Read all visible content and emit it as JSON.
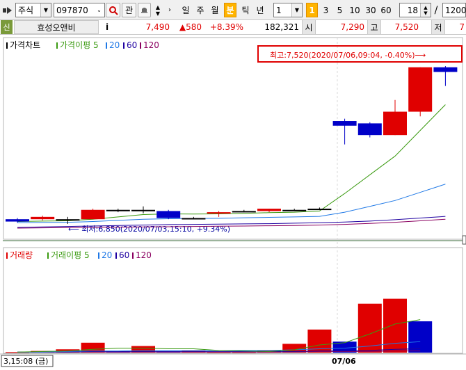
{
  "toolbar": {
    "market_label": "주식",
    "code_value": "097870",
    "watch_label": "관",
    "periods": [
      "일",
      "주",
      "월",
      "분",
      "틱",
      "년"
    ],
    "active_period": "분",
    "interval_value": "1",
    "minute_options": [
      "1",
      "3",
      "5",
      "10",
      "30",
      "60"
    ],
    "active_minute": "1",
    "view_count_value": "18",
    "slash": "/",
    "total_count_value": "1200"
  },
  "quote": {
    "badge": "신",
    "name": "효성오앤비",
    "info_label": "i",
    "price": "7,490",
    "change": "▲580",
    "change_rate": "+8.39%",
    "volume": "182,321",
    "open_label": "시",
    "open": "7,290",
    "high_label": "고",
    "high": "7,520",
    "low_label": "저",
    "low_partial": "7"
  },
  "colors": {
    "up": "#e00000",
    "down": "#0000c8",
    "ma5": "#3a9a10",
    "ma20": "#1e78e6",
    "ma60": "#1e00a0",
    "ma120": "#8a0060",
    "highlight": "#e00000"
  },
  "chart_data": [
    {
      "type": "candlestick",
      "title": "가격차트",
      "legend": [
        {
          "label": "가격이평 5",
          "color": "#3a9a10"
        },
        {
          "label": "20",
          "color": "#1e78e6"
        },
        {
          "label": "60",
          "color": "#1e00a0"
        },
        {
          "label": "120",
          "color": "#8a0060"
        }
      ],
      "annotations": {
        "high": "최고:7,520(2020/07/06,09:04, -0.40%)⟶",
        "low": "⟵ 최저:6,850(2020/07/03,15:10, +9.34%)"
      },
      "ylim": [
        6820,
        7540
      ],
      "candles": [
        {
          "open": 6870,
          "high": 6875,
          "low": 6855,
          "close": 6860,
          "color": "down"
        },
        {
          "open": 6870,
          "high": 6885,
          "low": 6865,
          "close": 6880,
          "color": "up"
        },
        {
          "open": 6870,
          "high": 6880,
          "low": 6850,
          "close": 6870,
          "color": "flat"
        },
        {
          "open": 6870,
          "high": 6915,
          "low": 6870,
          "close": 6910,
          "color": "up"
        },
        {
          "open": 6910,
          "high": 6915,
          "low": 6900,
          "close": 6910,
          "color": "flat"
        },
        {
          "open": 6910,
          "high": 6925,
          "low": 6895,
          "close": 6905,
          "color": "flat"
        },
        {
          "open": 6905,
          "high": 6910,
          "low": 6870,
          "close": 6875,
          "color": "down"
        },
        {
          "open": 6875,
          "high": 6880,
          "low": 6870,
          "close": 6870,
          "color": "flat"
        },
        {
          "open": 6895,
          "high": 6905,
          "low": 6880,
          "close": 6900,
          "color": "up"
        },
        {
          "open": 6905,
          "high": 6910,
          "low": 6900,
          "close": 6905,
          "color": "flat"
        },
        {
          "open": 6905,
          "high": 6915,
          "low": 6900,
          "close": 6915,
          "color": "up"
        },
        {
          "open": 6910,
          "high": 6915,
          "low": 6905,
          "close": 6910,
          "color": "flat"
        },
        {
          "open": 6915,
          "high": 6920,
          "low": 6910,
          "close": 6915,
          "color": "flat"
        },
        {
          "open": 7290,
          "high": 7300,
          "low": 7190,
          "close": 7270,
          "color": "down"
        },
        {
          "open": 7280,
          "high": 7285,
          "low": 7220,
          "close": 7230,
          "color": "down"
        },
        {
          "open": 7230,
          "high": 7380,
          "low": 7230,
          "close": 7330,
          "color": "up"
        },
        {
          "open": 7330,
          "high": 7520,
          "low": 7310,
          "close": 7520,
          "color": "up"
        },
        {
          "open": 7520,
          "high": 7525,
          "low": 7440,
          "close": 7500,
          "color": "down"
        }
      ],
      "ma5": [
        6860,
        6862,
        6863,
        6870,
        6880,
        6890,
        6893,
        6892,
        6893,
        6895,
        6898,
        6900,
        6905,
        6980,
        7060,
        7140,
        7250,
        7360
      ],
      "ma20": [
        6855,
        6856,
        6857,
        6860,
        6865,
        6870,
        6872,
        6873,
        6874,
        6876,
        6878,
        6880,
        6882,
        6900,
        6925,
        6950,
        6985,
        7020
      ],
      "ma60": [
        6835,
        6837,
        6839,
        6841,
        6843,
        6845,
        6847,
        6848,
        6849,
        6850,
        6851,
        6853,
        6855,
        6858,
        6862,
        6868,
        6875,
        6882
      ],
      "ma120": [
        6832,
        6833,
        6834,
        6835,
        6836,
        6837,
        6838,
        6839,
        6840,
        6841,
        6842,
        6843,
        6845,
        6848,
        6852,
        6857,
        6863,
        6870
      ]
    },
    {
      "type": "bar",
      "title": "거래량",
      "legend": [
        {
          "label": "거래이평 5",
          "color": "#3a9a10"
        },
        {
          "label": "20",
          "color": "#1e78e6"
        },
        {
          "label": "60",
          "color": "#1e00a0"
        },
        {
          "label": "120",
          "color": "#8a0060"
        }
      ],
      "ylim": [
        0,
        100
      ],
      "values": [
        1,
        3,
        6,
        18,
        2,
        12,
        2,
        3,
        1,
        1,
        4,
        16,
        42,
        20,
        89,
        98,
        57
      ],
      "colors": [
        "up",
        "up",
        "up",
        "up",
        "down",
        "up",
        "down",
        "up",
        "up",
        "up",
        "up",
        "up",
        "up",
        "down",
        "up",
        "up",
        "down"
      ],
      "ma5": [
        1,
        2,
        3,
        6,
        8,
        8,
        7,
        7,
        4,
        3,
        2,
        5,
        14,
        18,
        34,
        52,
        60
      ],
      "ma20": [
        1,
        1,
        2,
        3,
        3,
        4,
        4,
        4,
        4,
        4,
        4,
        5,
        7,
        8,
        12,
        17,
        20
      ],
      "ma60": [
        1,
        1,
        1,
        2,
        2,
        2,
        2,
        2,
        2,
        2,
        2,
        2,
        3,
        3,
        4,
        6,
        7
      ],
      "ma120": [
        1,
        1,
        1,
        1,
        1,
        1,
        1,
        1,
        1,
        1,
        1,
        1,
        2,
        2,
        2,
        3,
        3
      ]
    }
  ],
  "xaxis": {
    "left_time": "3,15:08 (금)",
    "date_label": "07/06"
  }
}
